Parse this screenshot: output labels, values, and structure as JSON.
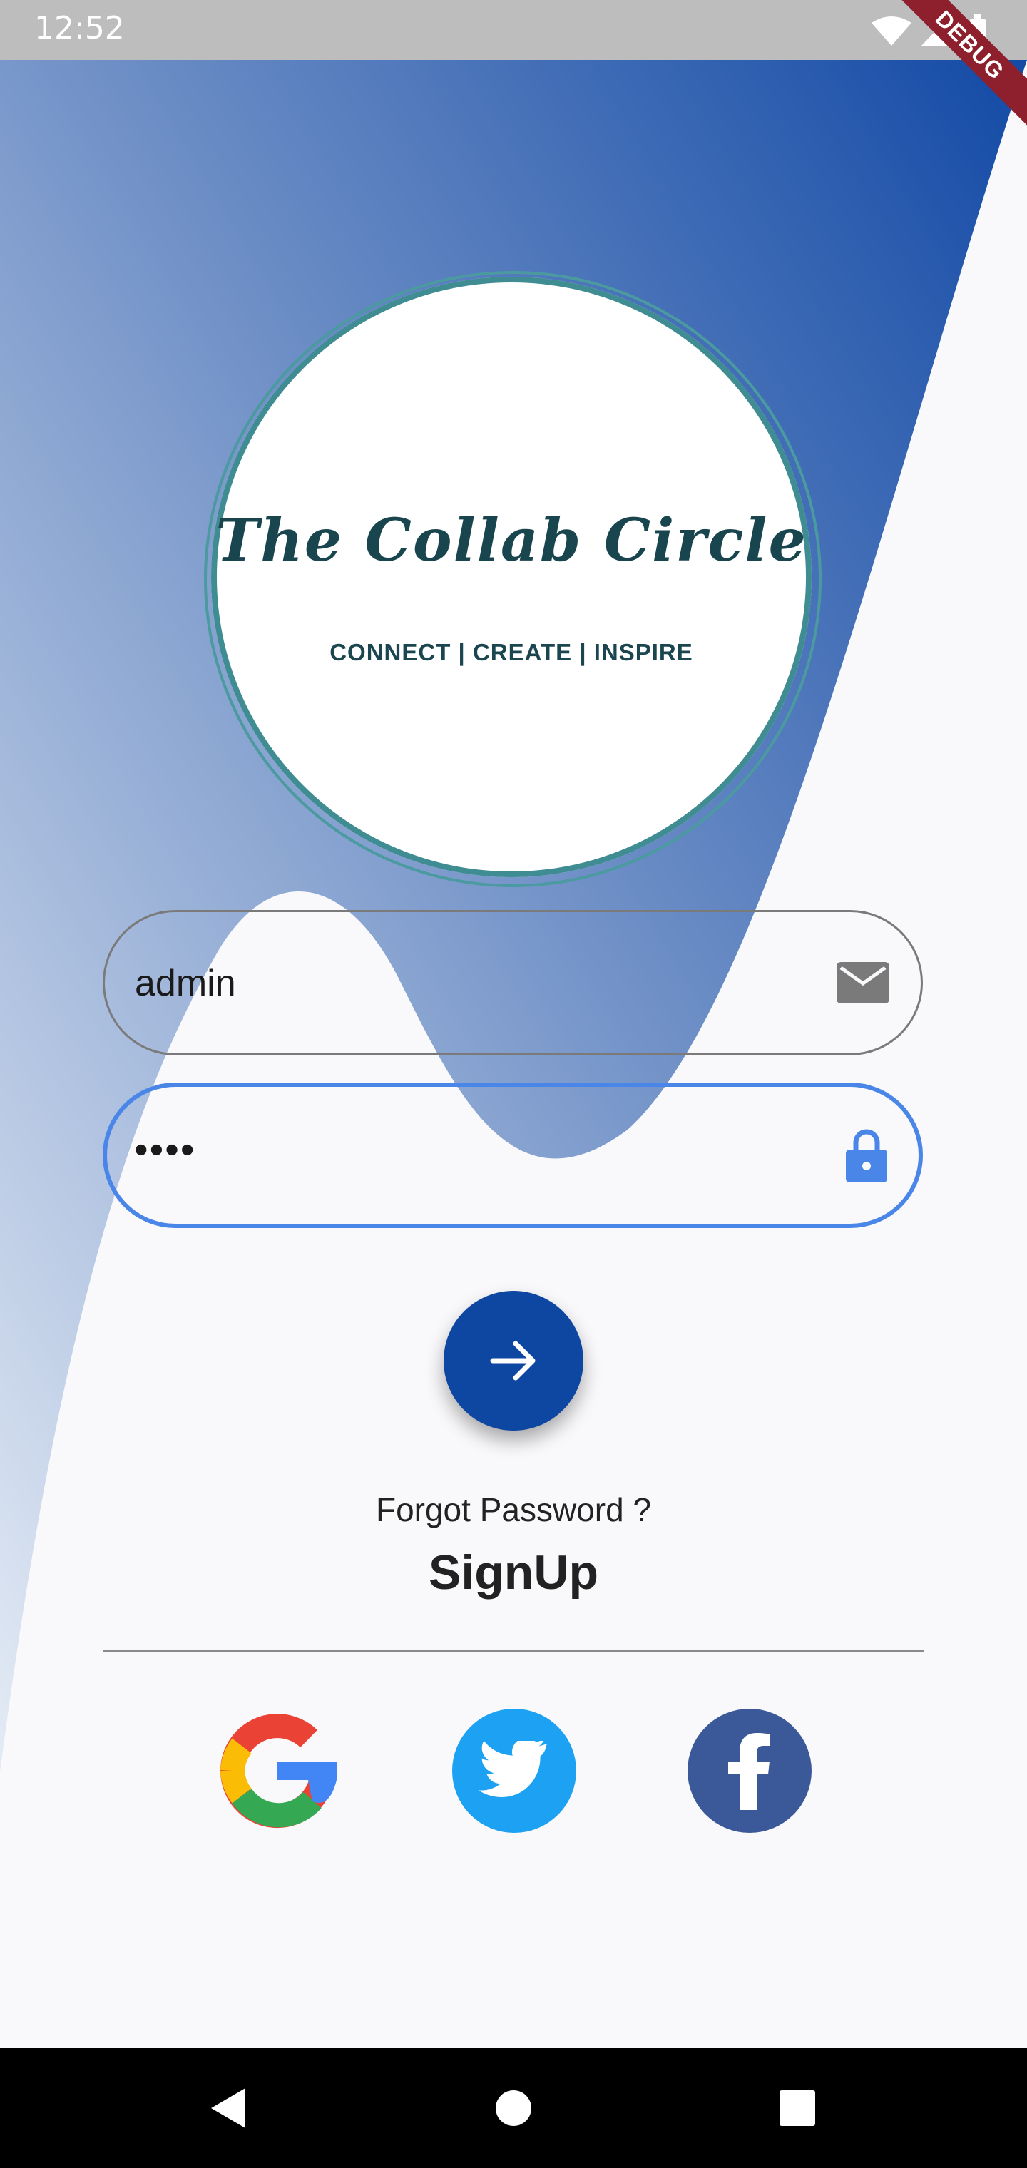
{
  "status_bar": {
    "time": "12:52",
    "icons": [
      "wifi-icon",
      "cell-signal-icon",
      "battery-icon"
    ],
    "debug_banner": "DEBUG"
  },
  "logo": {
    "title": "The Collab Circle",
    "tagline": "CONNECT | CREATE | INSPIRE"
  },
  "form": {
    "email": {
      "value": "admin",
      "icon": "mail-icon"
    },
    "password": {
      "value": "••••",
      "icon": "lock-icon"
    },
    "submit": {
      "icon": "arrow-right-icon"
    }
  },
  "links": {
    "forgot": "Forgot Password ?",
    "signup": "SignUp"
  },
  "social": [
    {
      "name": "google",
      "icon": "google-icon"
    },
    {
      "name": "twitter",
      "icon": "twitter-icon",
      "color": "#1da1f2"
    },
    {
      "name": "facebook",
      "icon": "facebook-icon",
      "color": "#3b5998"
    }
  ],
  "nav_bar": [
    "back-icon",
    "home-icon",
    "recents-icon"
  ],
  "colors": {
    "primary": "#0d47a1",
    "focus_border": "#4a86e8",
    "gradient_top": "#1e52aa",
    "gradient_bottom": "#d8e2f0"
  }
}
